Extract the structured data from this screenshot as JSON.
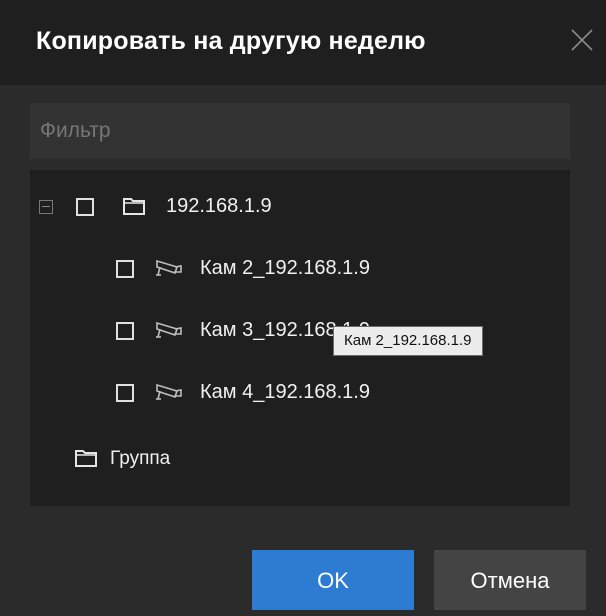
{
  "dialog": {
    "title": "Копировать на другую неделю",
    "close_icon": "close-icon"
  },
  "filter": {
    "placeholder": "Фильтр",
    "value": ""
  },
  "tree": {
    "root": {
      "label": "192.168.1.9",
      "expanded": true,
      "checked": false,
      "icon": "folder-icon"
    },
    "children": [
      {
        "label": "Кам 2_192.168.1.9",
        "checked": false,
        "icon": "camera-icon"
      },
      {
        "label": "Кам 3_192.168.1.9",
        "checked": false,
        "icon": "camera-icon"
      },
      {
        "label": "Кам 4_192.168.1.9",
        "checked": false,
        "icon": "camera-icon"
      }
    ],
    "group": {
      "label": "Группа",
      "icon": "folder-icon"
    }
  },
  "tooltip": {
    "text": "Кам 2_192.168.1.9"
  },
  "buttons": {
    "ok": "OK",
    "cancel": "Отмена"
  },
  "colors": {
    "accent": "#2e7bd2",
    "background": "#2b2b2b",
    "title_bar": "#1f1f1f"
  }
}
